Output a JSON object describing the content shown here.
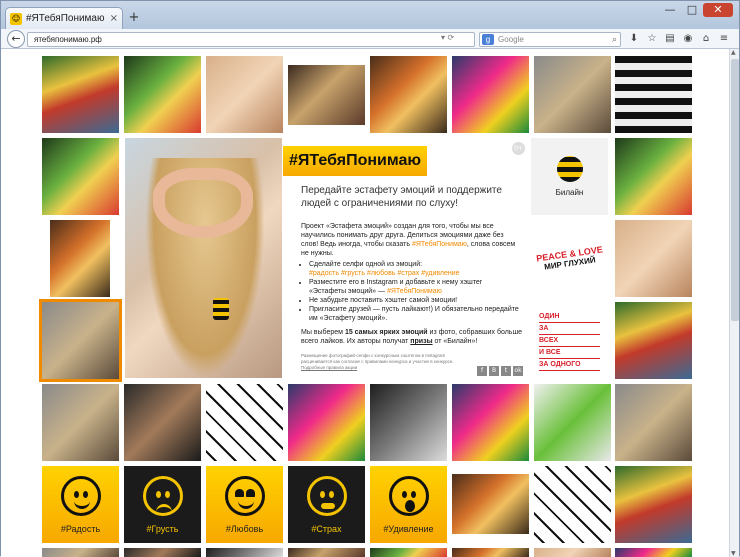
{
  "browser": {
    "tab_title": "#ЯТебяПонимаю - Передай...",
    "tab_close": "×",
    "new_tab": "+",
    "url": "ятебяпонимаю.рф",
    "search_placeholder": "Google",
    "window_buttons": [
      "—",
      "□",
      "✕"
    ]
  },
  "promo": {
    "hashtag": "#ЯТебяПонимаю",
    "age_badge": "0+",
    "subtitle": "Передайте эстафету эмоций и поддержите людей с ограничениями по слуху!",
    "intro_1": "Проект «Эстафета эмоций» создан для того, чтобы мы все научились понимать друг друга. Делиться эмоциями даже без слов! Ведь иногда, чтобы сказать ",
    "intro_hashtag": "#ЯТебяПонимаю",
    "intro_2": ", слова совсем не нужны.",
    "steps": [
      "Сделайте селфи одной из эмоций:",
      "Разместите его в Instagram и добавьте к нему хэштег «Эстафеты эмоций» — ",
      "Не забудьте поставить хэштег самой эмоции!",
      "Пригласите друзей — пусть лайкают!) И обязательно передайте им «Эстафету эмоций»."
    ],
    "emotion_tags": "#радость #грусть #любовь #страх #удивление",
    "relay_tag": "#ЯТебяПонимаю",
    "final_1": "Мы выберем ",
    "final_bold": "15 самых ярких эмоций",
    "final_2": " из фото, собравших больше всего лайков. Их авторы получат ",
    "final_prizes": "призы",
    "final_3": " от «Билайн»!",
    "small_print": "Размещение фотографий-селфи с конкурсным хэштегом в Instagram расценивается как согласие с правилами конкурса и участие в конкурсе.",
    "rules_link": "Подробные правила акции",
    "share_icons": [
      "f",
      "B",
      "t",
      "ok"
    ]
  },
  "beeline": {
    "name": "Билайн"
  },
  "rll": {
    "line1": "PEACE & LOVE",
    "line2": "МИР ГЛУХИЙ"
  },
  "odin": {
    "l1": "ОДИН",
    "l2": "ЗА",
    "l3": "ВСЕХ",
    "l4": "И ВСЕ",
    "l5": "ЗА ОДНОГО"
  },
  "emotions": [
    {
      "tag": "#Радость",
      "style": "yellow",
      "face": "happy"
    },
    {
      "tag": "#Грусть",
      "style": "black",
      "face": "sad"
    },
    {
      "tag": "#Любовь",
      "style": "yellow",
      "face": "love"
    },
    {
      "tag": "#Страх",
      "style": "black",
      "face": "fear"
    },
    {
      "tag": "#Удивление",
      "style": "yellow",
      "face": "wow"
    }
  ],
  "colors": {
    "accent": "#f5c400",
    "highlight": "#f08a00",
    "brand_red": "#d8202a"
  }
}
